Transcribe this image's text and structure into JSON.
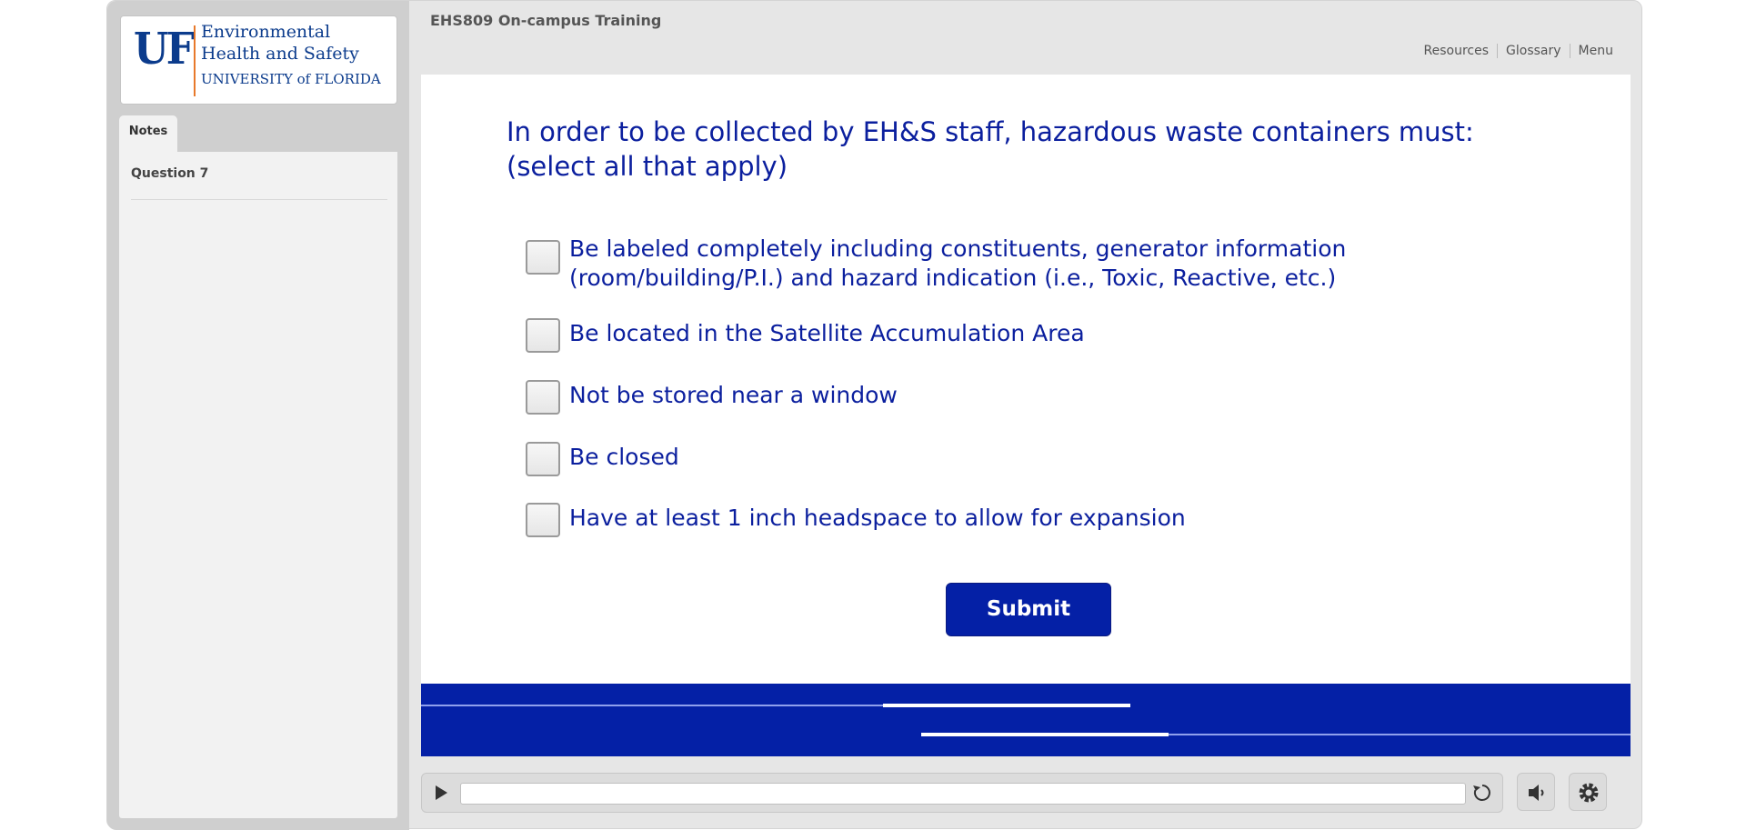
{
  "logo": {
    "mark": "UF",
    "line1": "Environmental",
    "line2": "Health and Safety",
    "line3": "UNIVERSITY of FLORIDA"
  },
  "sidebar": {
    "tab_label": "Notes",
    "items": [
      {
        "label": "Question 7"
      }
    ]
  },
  "header": {
    "title": "EHS809 On-campus Training",
    "links": [
      "Resources",
      "Glossary",
      "Menu"
    ]
  },
  "slide": {
    "question": "In order to be collected by EH&S staff, hazardous waste containers must:",
    "instruction": "(select all that apply)",
    "options": [
      {
        "label": "Be labeled completely including constituents, generator information (room/building/P.I.) and hazard indication (i.e., Toxic, Reactive, etc.)",
        "checked": false
      },
      {
        "label": "Be located in the Satellite Accumulation Area",
        "checked": false
      },
      {
        "label": "Not be stored near a window",
        "checked": false
      },
      {
        "label": "Be closed",
        "checked": false
      },
      {
        "label": "Have at least 1 inch headspace to allow for expansion",
        "checked": false
      }
    ],
    "submit_label": "Submit"
  },
  "player": {
    "icons": [
      "play-icon",
      "replay-icon",
      "volume-icon",
      "gear-icon"
    ],
    "accent_color": "#0420a6",
    "progress": 0
  }
}
